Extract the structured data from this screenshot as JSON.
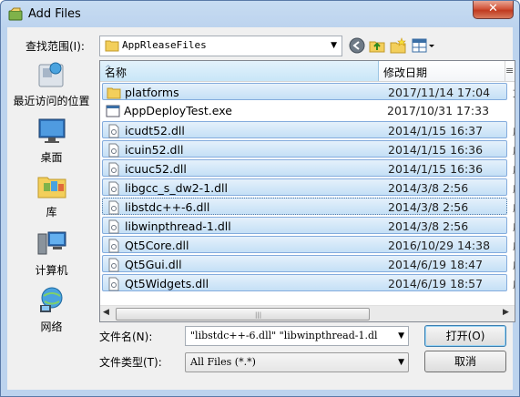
{
  "window": {
    "title": "Add Files",
    "close_glyph": "✕"
  },
  "lookin": {
    "label": "查找范围(I):",
    "value": "AppRleaseFiles"
  },
  "toolbar_icons": [
    "back-icon",
    "up-folder-icon",
    "new-folder-icon",
    "view-menu-icon"
  ],
  "places": [
    {
      "label": "最近访问的位置",
      "icon": "recent-places-icon"
    },
    {
      "label": "桌面",
      "icon": "desktop-icon"
    },
    {
      "label": "库",
      "icon": "libraries-icon"
    },
    {
      "label": "计算机",
      "icon": "computer-icon"
    },
    {
      "label": "网络",
      "icon": "network-icon"
    }
  ],
  "list": {
    "headers": {
      "name": "名称",
      "modified": "修改日期",
      "extra": "≡"
    },
    "rows": [
      {
        "name": "platforms",
        "date": "2017/11/14 17:04",
        "tail": "文",
        "type": "folder",
        "selected": true
      },
      {
        "name": "AppDeployTest.exe",
        "date": "2017/10/31 17:33",
        "tail": "",
        "type": "exe",
        "selected": false
      },
      {
        "name": "icudt52.dll",
        "date": "2014/1/15 16:37",
        "tail": "应",
        "type": "dll",
        "selected": true
      },
      {
        "name": "icuin52.dll",
        "date": "2014/1/15 16:36",
        "tail": "应",
        "type": "dll",
        "selected": true
      },
      {
        "name": "icuuc52.dll",
        "date": "2014/1/15 16:36",
        "tail": "应",
        "type": "dll",
        "selected": true
      },
      {
        "name": "libgcc_s_dw2-1.dll",
        "date": "2014/3/8 2:56",
        "tail": "应",
        "type": "dll",
        "selected": true
      },
      {
        "name": "libstdc++-6.dll",
        "date": "2014/3/8 2:56",
        "tail": "应",
        "type": "dll",
        "selected": true
      },
      {
        "name": "libwinpthread-1.dll",
        "date": "2014/3/8 2:56",
        "tail": "应",
        "type": "dll",
        "selected": true
      },
      {
        "name": "Qt5Core.dll",
        "date": "2016/10/29 14:38",
        "tail": "应",
        "type": "dll",
        "selected": true
      },
      {
        "name": "Qt5Gui.dll",
        "date": "2014/6/19 18:47",
        "tail": "应",
        "type": "dll",
        "selected": true
      },
      {
        "name": "Qt5Widgets.dll",
        "date": "2014/6/19 18:57",
        "tail": "应",
        "type": "dll",
        "selected": true
      }
    ],
    "focused_row": 6
  },
  "filename": {
    "label": "文件名(N):",
    "value": "\"libstdc++-6.dll\" \"libwinpthread-1.dl"
  },
  "filetype": {
    "label": "文件类型(T):",
    "value": "All Files (*.*)"
  },
  "buttons": {
    "open": "打开(O)",
    "cancel": "取消"
  }
}
